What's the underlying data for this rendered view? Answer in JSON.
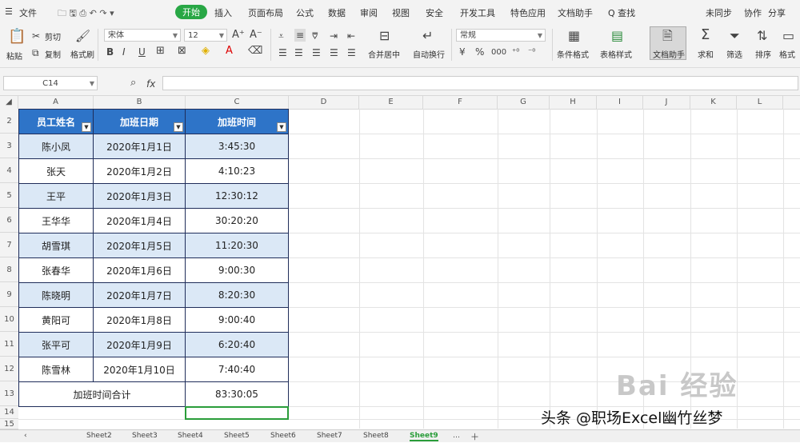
{
  "menu": {
    "items": [
      "文件",
      "开始",
      "插入",
      "页面布局",
      "公式",
      "数据",
      "审阅",
      "视图",
      "安全",
      "开发工具",
      "特色应用",
      "文档助手",
      "Q 查找"
    ],
    "right": [
      "未同步",
      "协作",
      "分享"
    ]
  },
  "ribbon": {
    "paste": "粘贴",
    "cut": "剪切",
    "copy": "复制",
    "format_painter": "格式刷",
    "font_name": "宋体",
    "font_size": "12",
    "merge_center": "合并居中",
    "wrap_text": "自动换行",
    "number_format": "常规",
    "cond_format": "条件格式",
    "table_style": "表格样式",
    "doc_helper": "文档助手",
    "sum": "求和",
    "filter": "筛选",
    "sort": "排序",
    "fill": "格式"
  },
  "formula_bar": {
    "name_box": "C14",
    "fx": "fx",
    "value": ""
  },
  "columns": [
    "A",
    "B",
    "C",
    "D",
    "E",
    "F",
    "G",
    "H",
    "I",
    "J",
    "K",
    "L"
  ],
  "rows": [
    "2",
    "3",
    "4",
    "5",
    "6",
    "7",
    "8",
    "9",
    "10",
    "11",
    "12",
    "13",
    "14",
    "15"
  ],
  "table": {
    "headers": [
      "员工姓名",
      "加班日期",
      "加班时间"
    ],
    "rows": [
      [
        "陈小凤",
        "2020年1月1日",
        "3:45:30"
      ],
      [
        "张天",
        "2020年1月2日",
        "4:10:23"
      ],
      [
        "王平",
        "2020年1月3日",
        "12:30:12"
      ],
      [
        "王华华",
        "2020年1月4日",
        "30:20:20"
      ],
      [
        "胡雪琪",
        "2020年1月5日",
        "11:20:30"
      ],
      [
        "张春华",
        "2020年1月6日",
        "9:00:30"
      ],
      [
        "陈晓明",
        "2020年1月7日",
        "8:20:30"
      ],
      [
        "黄阳可",
        "2020年1月8日",
        "9:00:40"
      ],
      [
        "张平可",
        "2020年1月9日",
        "6:20:40"
      ],
      [
        "陈雪林",
        "2020年1月10日",
        "7:40:40"
      ]
    ],
    "total_label": "加班时间合计",
    "total_value": "83:30:05"
  },
  "sheet_tabs": [
    "Sheet2",
    "Sheet3",
    "Sheet4",
    "Sheet5",
    "Sheet6",
    "Sheet7",
    "Sheet8",
    "Sheet9"
  ],
  "active_tab": "Sheet9",
  "watermark": {
    "baidu": "Bai 经验",
    "author": "头条 @职场Excel幽竹丝梦"
  }
}
